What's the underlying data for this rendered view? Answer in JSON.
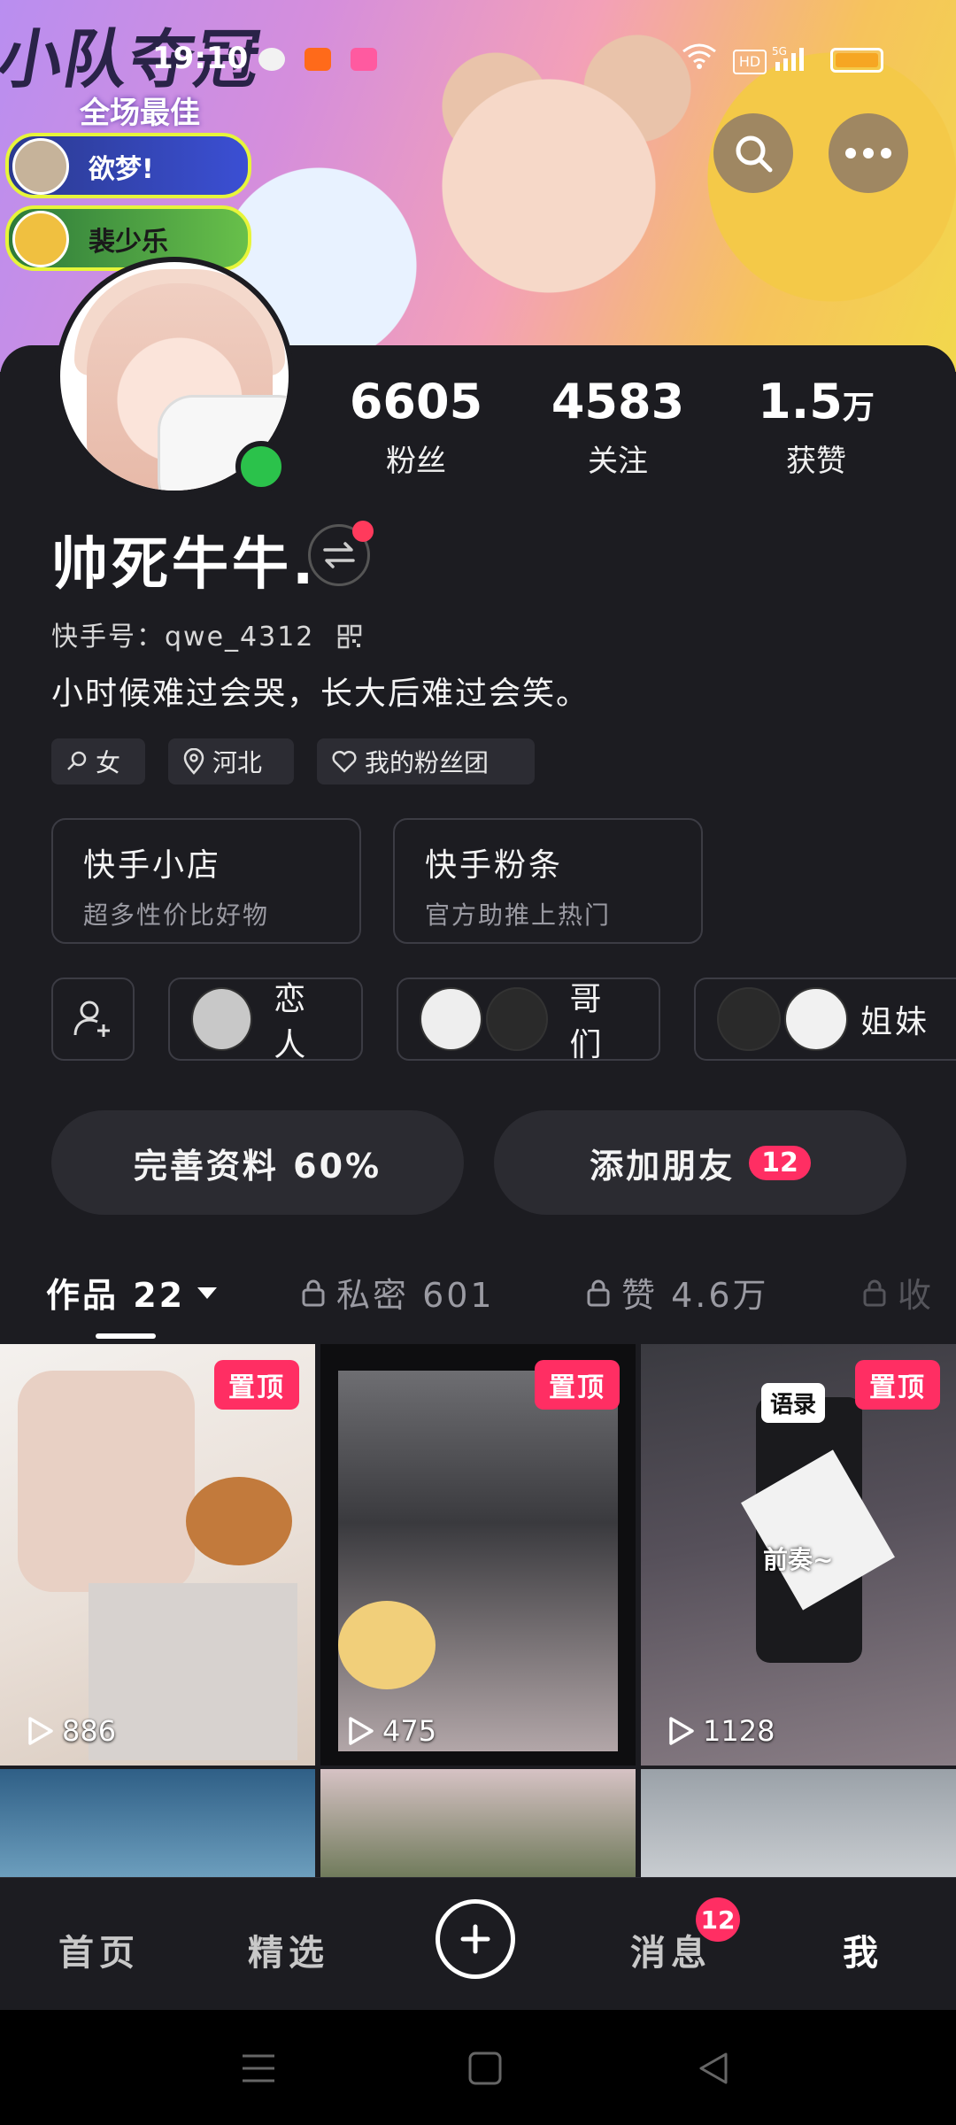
{
  "status_bar": {
    "time": "19:10",
    "network": "HD",
    "cellular": "5G"
  },
  "banner": {
    "title": "小队夺冠",
    "subtitle": "全场最佳",
    "chips": [
      "欲梦!",
      "裴少乐"
    ]
  },
  "header": {
    "search_icon": "search-icon",
    "more_icon": "more-icon"
  },
  "profile": {
    "name": "帅死牛牛.",
    "kuaishou_id": "快手号：qwe_4312",
    "bio": "小时候难过会哭，长大后难过会笑。",
    "stats": [
      {
        "value": "6605",
        "unit": "",
        "label": "粉丝"
      },
      {
        "value": "4583",
        "unit": "",
        "label": "关注"
      },
      {
        "value": "1.5",
        "unit": "万",
        "label": "获赞"
      }
    ],
    "tags": [
      "女",
      "河北",
      "我的粉丝团"
    ]
  },
  "cards": [
    {
      "title": "快手小店",
      "subtitle": "超多性价比好物"
    },
    {
      "title": "快手粉条",
      "subtitle": "官方助推上热门"
    }
  ],
  "relations": [
    "恋人",
    "哥们",
    "姐妹"
  ],
  "actions": {
    "complete_profile": "完善资料 60%",
    "add_friends": "添加朋友",
    "add_friends_badge": "12"
  },
  "tabs": [
    {
      "label": "作品 22"
    },
    {
      "label": "私密 601"
    },
    {
      "label": "赞 4.6万"
    },
    {
      "label": "收"
    }
  ],
  "videos": [
    {
      "pinned_label": "置顶",
      "plays": "886"
    },
    {
      "pinned_label": "置顶",
      "plays": "475"
    },
    {
      "pinned_label": "置顶",
      "plays": "1128",
      "overlay_texts": [
        "语录",
        "前奏~"
      ]
    }
  ],
  "bottom_nav": {
    "items": [
      "首页",
      "精选",
      "消息",
      "我"
    ],
    "messages_badge": "12"
  },
  "colors": {
    "accent": "#ff2e63",
    "background": "#1c1c21",
    "online": "#2bc24b"
  }
}
